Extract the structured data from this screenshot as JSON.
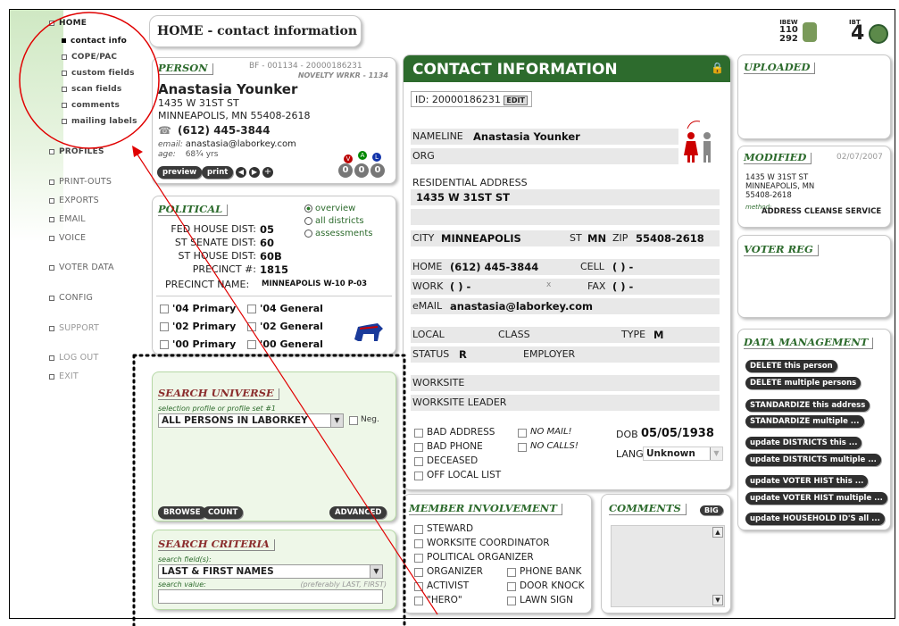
{
  "sidebar": {
    "home": "HOME",
    "home_items": [
      "contact info",
      "COPE/PAC",
      "custom fields",
      "scan fields",
      "comments",
      "mailing labels"
    ],
    "sections": [
      "PROFILES",
      "PRINT-OUTS",
      "EXPORTS",
      "EMAIL",
      "VOICE",
      "VOTER DATA",
      "CONFIG",
      "SUPPORT",
      "LOG OUT",
      "EXIT"
    ]
  },
  "header": {
    "title": "HOME - contact information"
  },
  "logo": {
    "l1": "IBEW",
    "l2": "110",
    "l3": "292",
    "l4": "IBT",
    "l5": "4"
  },
  "person": {
    "title": "PERSON",
    "bf": "BF - 001134 - 20000186231",
    "sub": "NOVELTY WRKR - 1134",
    "name": "Anastasia Younker",
    "addr1": "1435 W 31ST ST",
    "addr2": "MINNEAPOLIS, MN 55408-2618",
    "phone": "(612) 445-3844",
    "email_label": "email:",
    "email": "anastasia@laborkey.com",
    "age_label": "age:",
    "age": "68¾ yrs",
    "preview": "preview",
    "print": "print",
    "vlabels": [
      "V",
      "A",
      "L"
    ],
    "vvals": [
      "0",
      "0",
      "0"
    ]
  },
  "political": {
    "title": "POLITICAL",
    "radios": [
      "overview",
      "all districts",
      "assessments"
    ],
    "fed_label": "FED HOUSE DIST:",
    "fed": "05",
    "sen_label": "ST SENATE DIST:",
    "sen": "60",
    "sth_label": "ST HOUSE DIST:",
    "sth": "60B",
    "pre_label": "PRECINCT #:",
    "pre": "1815",
    "pn_label": "PRECINCT NAME:",
    "pn": "MINNEAPOLIS W-10 P-03",
    "elections": [
      "'04 Primary",
      "'04 General",
      "'02 Primary",
      "'02 General",
      "'00 Primary",
      "'00 General"
    ]
  },
  "search_universe": {
    "title": "SEARCH UNIVERSE",
    "hint": "selection profile or profile set #1",
    "value": "ALL PERSONS IN LABORKEY",
    "neg": "Neg.",
    "browse": "BROWSE",
    "count": "COUNT",
    "advanced": "ADVANCED"
  },
  "search_criteria": {
    "title": "SEARCH CRITERIA",
    "field_hint": "search field(s):",
    "field_value": "LAST & FIRST NAMES",
    "value_hint": "search value:",
    "value_hint2": "(preferably LAST, FIRST)"
  },
  "contact": {
    "title": "CONTACT INFORMATION",
    "id_label": "ID: 20000186231",
    "edit": "EDIT",
    "nameline_label": "NAMELINE",
    "nameline": "Anastasia Younker",
    "org_label": "ORG",
    "res_label": "RESIDENTIAL ADDRESS",
    "res": "1435 W 31ST ST",
    "city_label": "CITY",
    "city": "MINNEAPOLIS",
    "st_label": "ST",
    "st": "MN",
    "zip_label": "ZIP",
    "zip": "55408-2618",
    "home_label": "HOME",
    "home": "(612) 445-3844",
    "cell_label": "CELL",
    "cell": "(  )  -",
    "work_label": "WORK",
    "work": "(  )  -",
    "work_x": "x",
    "fax_label": "FAX",
    "fax": "(  )  -",
    "email_label": "eMAIL",
    "email": "anastasia@laborkey.com",
    "local_label": "LOCAL",
    "class_label": "CLASS",
    "type_label": "TYPE",
    "type": "M",
    "status_label": "STATUS",
    "status": "R",
    "employer_label": "EMPLOYER",
    "worksite_label": "WORKSITE",
    "leader_label": "WORKSITE LEADER",
    "flags": [
      "BAD ADDRESS",
      "BAD PHONE",
      "DECEASED",
      "OFF LOCAL LIST"
    ],
    "nomail": "NO MAIL!",
    "nocalls": "NO CALLS!",
    "dob_label": "DOB",
    "dob": "05/05/1938",
    "lang_label": "LANG",
    "lang": "Unknown"
  },
  "member": {
    "title": "MEMBER INVOLVEMENT",
    "items": [
      "STEWARD",
      "WORKSITE COORDINATOR",
      "POLITICAL ORGANIZER",
      "ORGANIZER",
      "ACTIVIST",
      "\"HERO\""
    ],
    "items2": [
      "PHONE BANK",
      "DOOR KNOCK",
      "LAWN SIGN"
    ]
  },
  "comments": {
    "title": "COMMENTS",
    "big": "BIG"
  },
  "uploaded": {
    "title": "UPLOADED"
  },
  "modified": {
    "title": "MODIFIED",
    "date": "02/07/2007",
    "l1": "1435 W 31ST ST",
    "l2": "MINNEAPOLIS, MN",
    "l3": "55408-2618",
    "method_label": "method:",
    "method": "ADDRESS CLEANSE SERVICE"
  },
  "voter": {
    "title": "VOTER REG"
  },
  "data_mgmt": {
    "title": "DATA MANAGEMENT",
    "buttons": [
      "DELETE this person",
      "DELETE multiple persons",
      "STANDARDIZE this address",
      "STANDARDIZE multiple ...",
      "update DISTRICTS this ...",
      "update DISTRICTS multiple ...",
      "update VOTER HIST this ...",
      "update VOTER HIST multiple ...",
      "update HOUSEHOLD ID'S all ..."
    ]
  },
  "colors": {
    "accent": "#2d6b2d",
    "annotation": "#e00000"
  }
}
